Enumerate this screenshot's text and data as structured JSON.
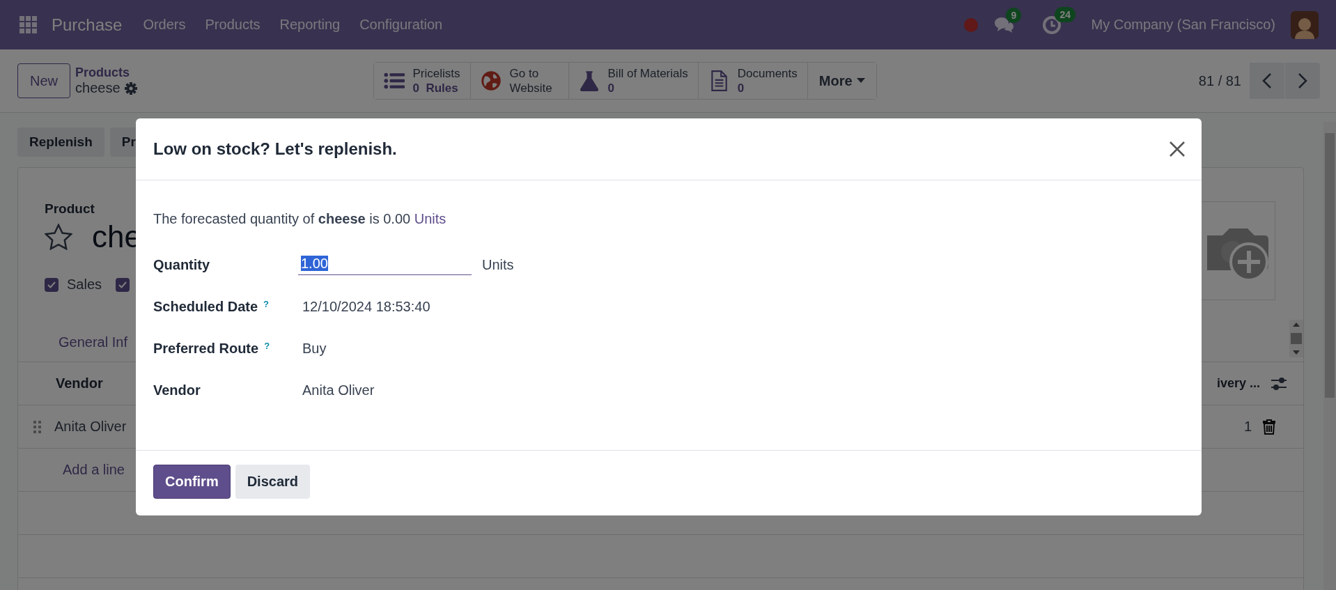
{
  "navbar": {
    "app_name": "Purchase",
    "menu": [
      "Orders",
      "Products",
      "Reporting",
      "Configuration"
    ],
    "message_count": "9",
    "activity_count": "24",
    "company": "My Company (San Francisco)"
  },
  "control_panel": {
    "new_button": "New",
    "breadcrumb": {
      "parent": "Products",
      "current": "cheese"
    },
    "stat_buttons": [
      {
        "kind": "list",
        "label": "Pricelists",
        "value": "0  Rules"
      },
      {
        "kind": "globe",
        "label": "Go to Website"
      },
      {
        "kind": "flask",
        "label": "Bill of Materials",
        "value": "0"
      },
      {
        "kind": "document",
        "label": "Documents",
        "value": "0"
      }
    ],
    "more_button": "More",
    "pager": "81 / 81"
  },
  "form": {
    "action_buttons": [
      "Replenish",
      "Pr"
    ],
    "product_label": "Product",
    "favorite": false,
    "name": "che",
    "options": [
      {
        "label": "Sales",
        "checked": true
      },
      {
        "checked": true
      }
    ],
    "tabs": [
      "General Inf"
    ],
    "table": {
      "columns": [
        "Vendor",
        "ivery ..."
      ],
      "rows": [
        {
          "vendor": "Anita Oliver",
          "column_2": "1"
        }
      ],
      "add_line": "Add a line"
    }
  },
  "dialog": {
    "title": "Low on stock? Let's replenish.",
    "message": "The forecasted quantity of **cheese** is 0.00",
    "message_unit": "Units",
    "fields": [
      {
        "kind": "input",
        "label": "Quantity",
        "value": "1.00",
        "unit": "Units"
      },
      {
        "kind": "text",
        "label": "Scheduled Date",
        "help": "?",
        "value": "12/10/2024 18:53:40"
      },
      {
        "kind": "text",
        "label": "Preferred Route",
        "help": "?",
        "value": "Buy"
      },
      {
        "kind": "text",
        "label": "Vendor",
        "value": "Anita Oliver"
      }
    ],
    "buttons": [
      {
        "kind": "primary",
        "label": "Confirm"
      },
      {
        "kind": "secondary",
        "label": "Discard"
      }
    ]
  }
}
